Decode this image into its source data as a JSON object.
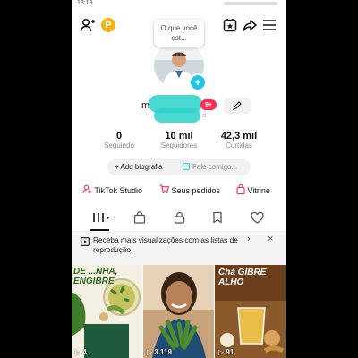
{
  "status_bar": {
    "time": "13:19"
  },
  "header": {
    "add_user_icon": "add-user-icon",
    "coin_badge": "P",
    "calendar_icon": "calendar-star-icon",
    "share_icon": "share-icon",
    "menu_icon": "menu-icon"
  },
  "profile": {
    "bubble_text": "O que você est...",
    "name_prefix": "m",
    "name_suffix": "o",
    "notif_badge": "9+",
    "stats": [
      {
        "value": "0",
        "label": "Seguindo"
      },
      {
        "value": "10 mil",
        "label": "Seguidores"
      },
      {
        "value": "42,3 mil",
        "label": "Curtidas"
      }
    ],
    "add_bio": "+ Add biografia",
    "chat": "Fale comigo..."
  },
  "shortcuts": [
    {
      "label": "TikTok Studio",
      "icon": "user-star-icon"
    },
    {
      "label": "Seus pedidos",
      "icon": "cart-icon"
    },
    {
      "label": "Vitrine",
      "icon": "bag-icon"
    }
  ],
  "tabs": {
    "items": [
      "grid-icon",
      "shop-bag-icon",
      "lock-icon",
      "bookmark-icon",
      "heart-icon"
    ]
  },
  "banner": {
    "text": "Receba mais visualizações com as listas de reprodução",
    "close": "×",
    "chevron": "›"
  },
  "videos": [
    {
      "title": "DE ...NHA, ENGIBRE",
      "views": "4"
    },
    {
      "title": "",
      "views": "3.119"
    },
    {
      "title": "Chá GIBRE ALHO",
      "views": "91"
    }
  ],
  "colors": {
    "accent": "#fe2c55",
    "teal": "#2ad4c9",
    "coin": "#f5b21a"
  }
}
